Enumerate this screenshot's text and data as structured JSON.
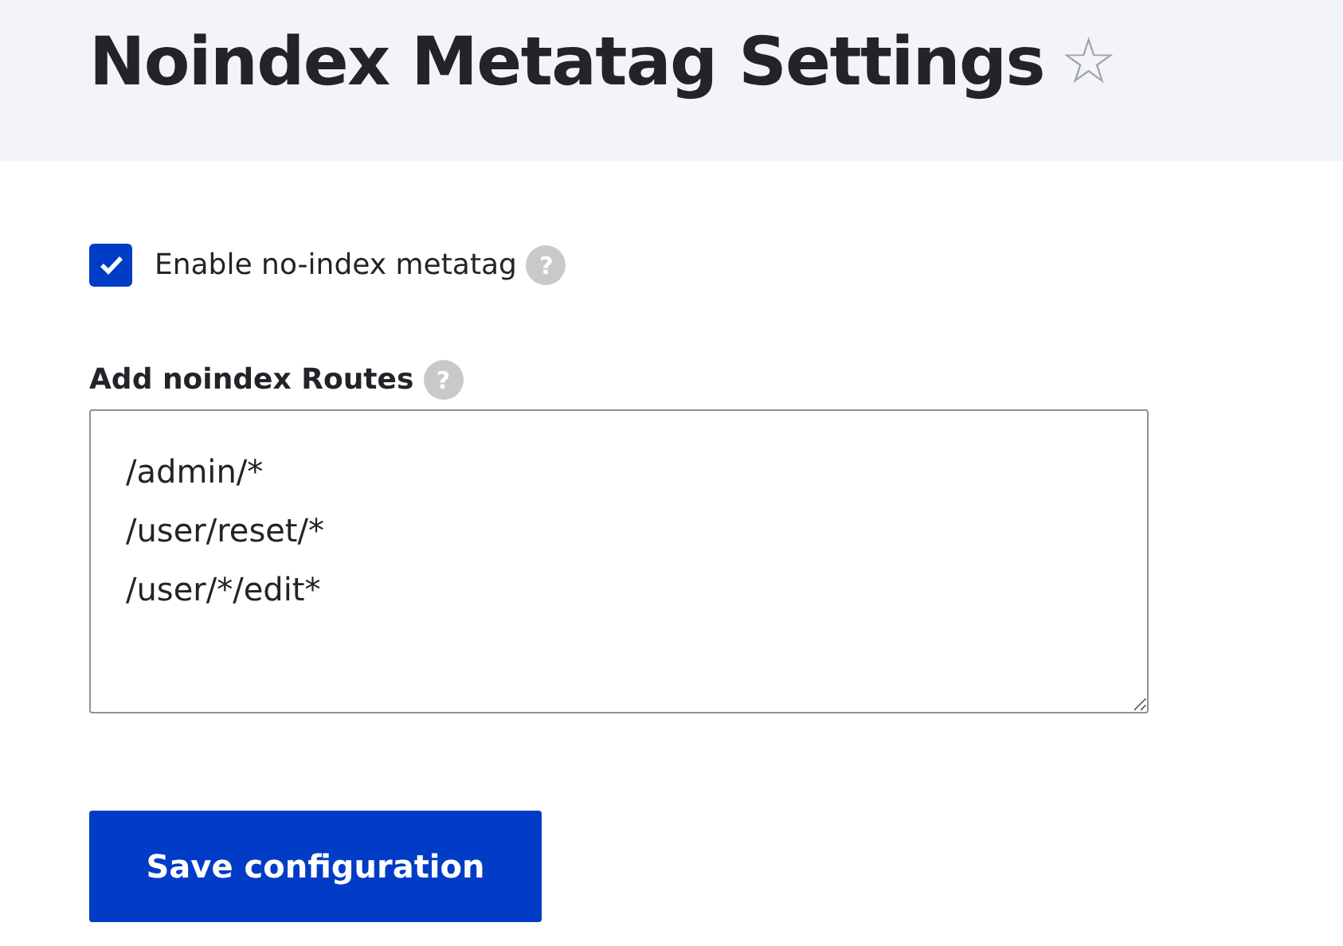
{
  "page": {
    "title": "Noindex Metatag Settings",
    "favorite_star": "☆"
  },
  "enable_checkbox": {
    "label": "Enable no-index metatag",
    "checked": true,
    "help": "?"
  },
  "routes_field": {
    "label": "Add noindex Routes",
    "help": "?",
    "value": [
      "/admin/*",
      "/user/reset/*",
      "/user/*/edit*"
    ]
  },
  "buttons": [
    {
      "label": "Save configuration"
    }
  ]
}
